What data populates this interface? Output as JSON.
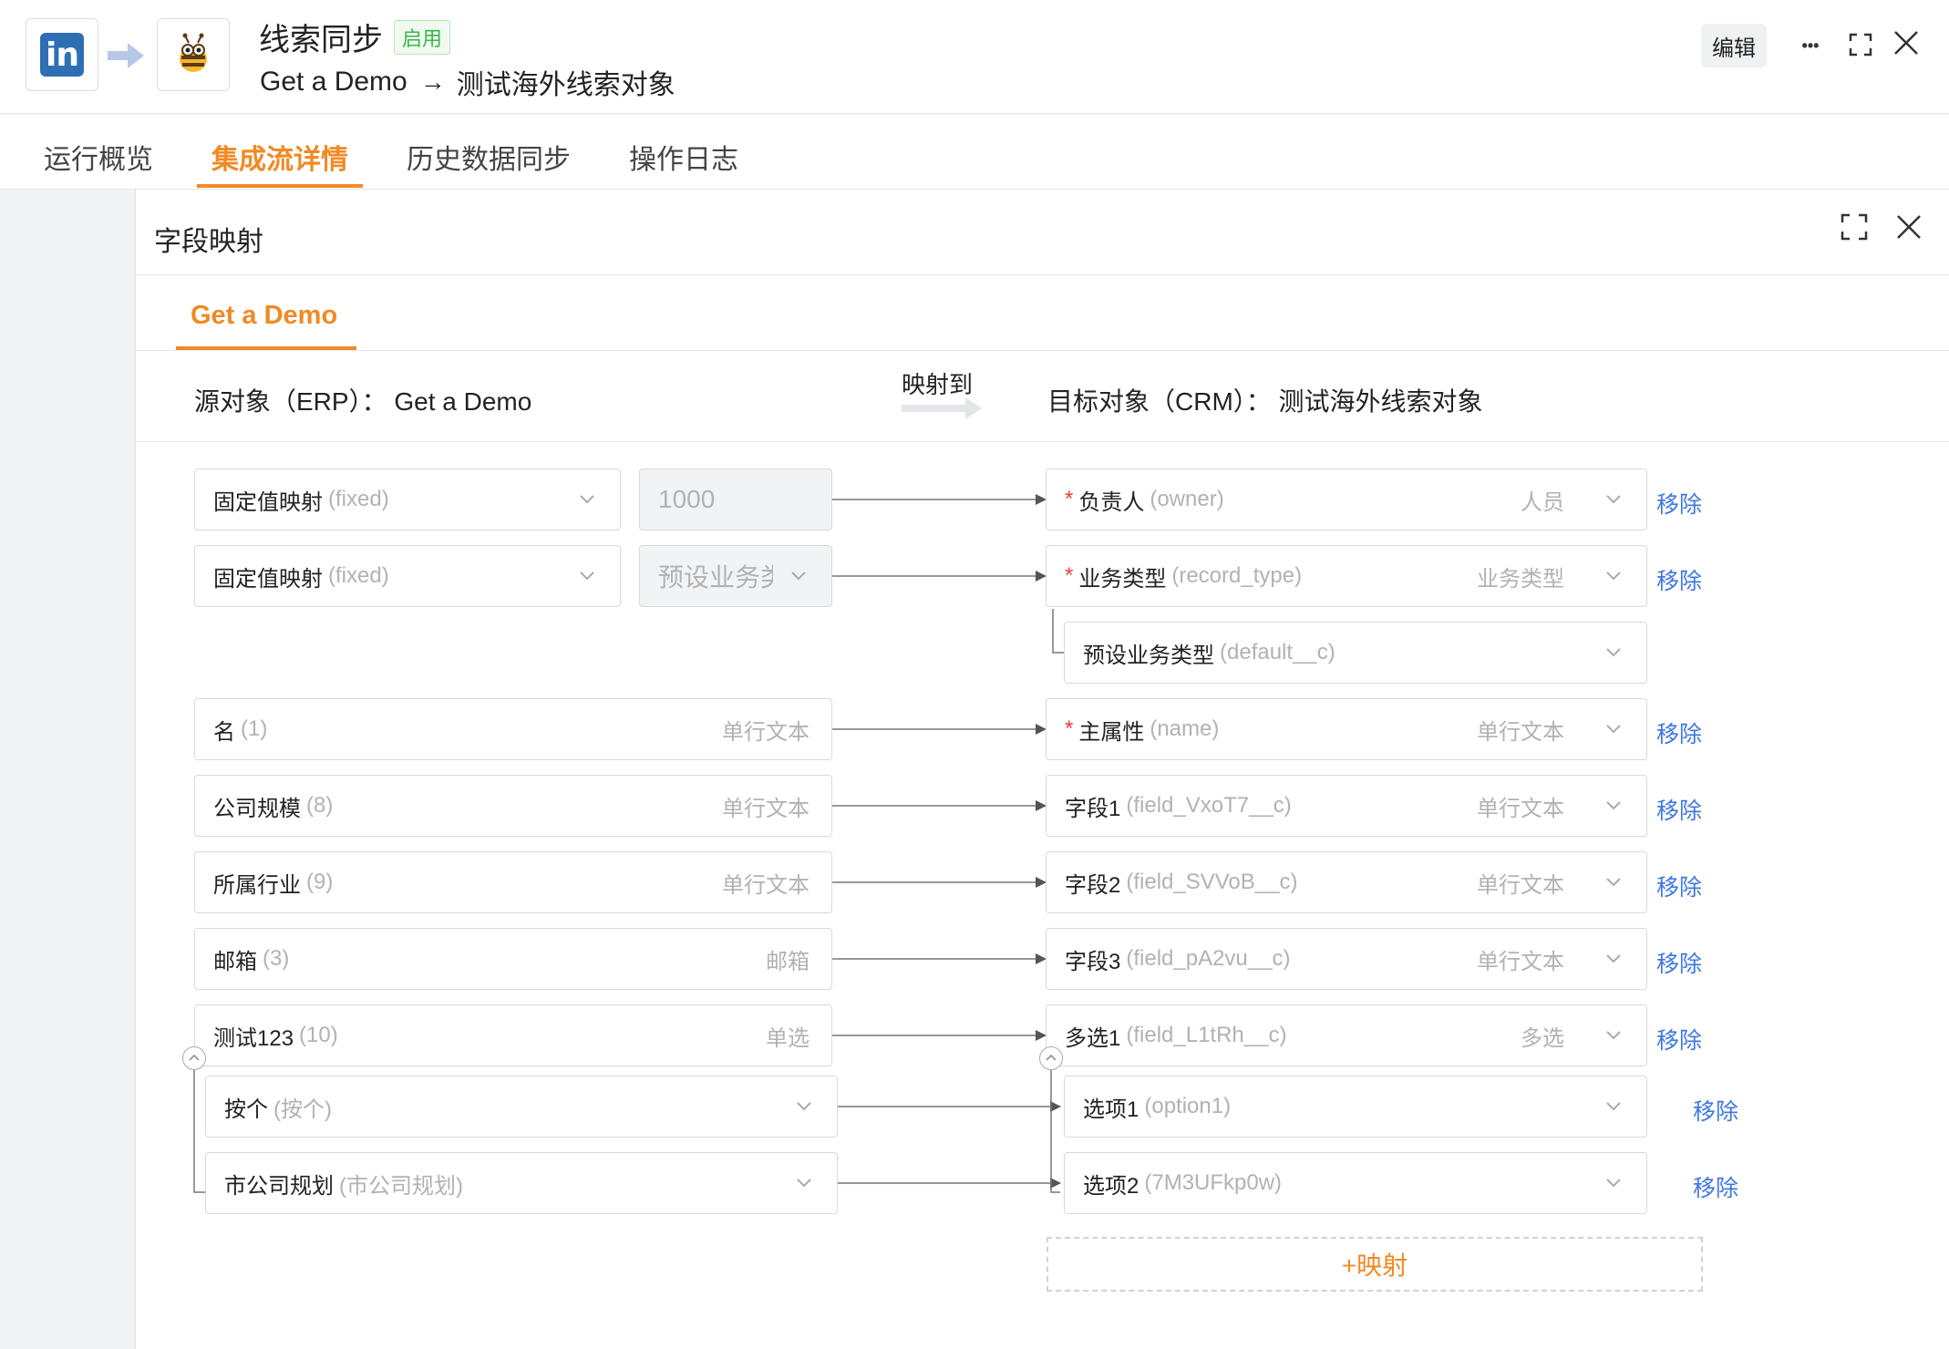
{
  "header": {
    "title": "线索同步",
    "status": "启用",
    "source_name": "Get a Demo",
    "target_name": "测试海外线索对象",
    "subtitle_arrow": "→",
    "edit_label": "编辑",
    "more_label": "•••",
    "linkedin_logo_text": "in"
  },
  "tabs": [
    "运行概览",
    "集成流详情",
    "历史数据同步",
    "操作日志"
  ],
  "panel": {
    "title": "字段映射",
    "object_tab": "Get a Demo",
    "source_object": "源对象（ERP）： Get a Demo",
    "map_to_label": "映射到",
    "target_object": "目标对象（CRM）： 测试海外线索对象",
    "remove_label": "移除",
    "add_mapping_label": "+映射"
  },
  "mappings": [
    {
      "src": "固定值映射",
      "src_api": "(fixed)",
      "value": "1000",
      "tgt": "负责人",
      "tgt_api": "(owner)",
      "tgt_type": "人员",
      "required": true
    },
    {
      "src": "固定值映射",
      "src_api": "(fixed)",
      "value": "预设业务类",
      "tgt": "业务类型",
      "tgt_api": "(record_type)",
      "tgt_type": "业务类型",
      "required": true,
      "sub_tgt": "预设业务类型",
      "sub_tgt_api": "(default__c)"
    },
    {
      "src": "名",
      "src_api": "(1)",
      "src_type": "单行文本",
      "tgt": "主属性",
      "tgt_api": "(name)",
      "tgt_type": "单行文本",
      "required": true
    },
    {
      "src": "公司规模",
      "src_api": "(8)",
      "src_type": "单行文本",
      "tgt": "字段1",
      "tgt_api": "(field_VxoT7__c)",
      "tgt_type": "单行文本"
    },
    {
      "src": "所属行业",
      "src_api": "(9)",
      "src_type": "单行文本",
      "tgt": "字段2",
      "tgt_api": "(field_SVVoB__c)",
      "tgt_type": "单行文本"
    },
    {
      "src": "邮箱",
      "src_api": "(3)",
      "src_type": "邮箱",
      "tgt": "字段3",
      "tgt_api": "(field_pA2vu__c)",
      "tgt_type": "单行文本"
    },
    {
      "src": "测试123",
      "src_api": "(10)",
      "src_type": "单选",
      "tgt": "多选1",
      "tgt_api": "(field_L1tRh__c)",
      "tgt_type": "多选"
    }
  ],
  "options": [
    {
      "src": "按个",
      "src_api": "(按个)",
      "tgt": "选项1",
      "tgt_api": "(option1)"
    },
    {
      "src": "市公司规划",
      "src_api": "(市公司规划)",
      "tgt": "选项2",
      "tgt_api": "(7M3UFkp0w)"
    }
  ],
  "colors": {
    "accent": "#f08a24",
    "link": "#3f78e0",
    "status_green": "#3bb54a",
    "required": "#e8402f",
    "linkedin": "#2e6fb4"
  },
  "icons": [
    "linkedin-icon",
    "bee-app-icon",
    "arrow-right-icon",
    "more-icon",
    "expand-icon",
    "close-icon",
    "chevron-down-icon",
    "collapse-icon"
  ]
}
